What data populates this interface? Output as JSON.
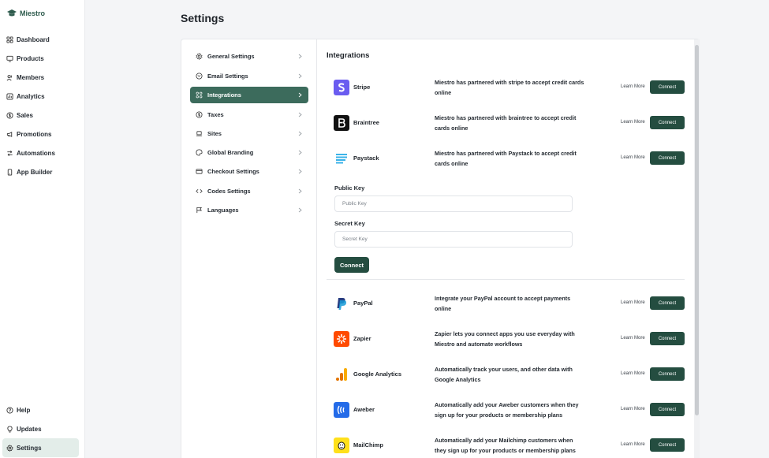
{
  "brand": {
    "name": "Miestro",
    "color": "#2d5a4c"
  },
  "sidebar": {
    "items": [
      {
        "label": "Dashboard",
        "icon": "grid-icon"
      },
      {
        "label": "Products",
        "icon": "monitor-icon"
      },
      {
        "label": "Members",
        "icon": "users-icon"
      },
      {
        "label": "Analytics",
        "icon": "chart-icon"
      },
      {
        "label": "Sales",
        "icon": "dollar-icon"
      },
      {
        "label": "Promotions",
        "icon": "megaphone-icon"
      },
      {
        "label": "Automations",
        "icon": "arrows-icon"
      },
      {
        "label": "App Builder",
        "icon": "phone-icon"
      }
    ],
    "bottom": [
      {
        "label": "Help",
        "icon": "help-icon"
      },
      {
        "label": "Updates",
        "icon": "bulb-icon"
      },
      {
        "label": "Settings",
        "icon": "gear-icon",
        "active": true
      }
    ]
  },
  "page": {
    "title": "Settings"
  },
  "settings_menu": [
    {
      "label": "General Settings",
      "icon": "gear-icon"
    },
    {
      "label": "Email Settings",
      "icon": "mail-icon"
    },
    {
      "label": "Integrations",
      "icon": "integrations-icon",
      "active": true
    },
    {
      "label": "Taxes",
      "icon": "dollar-icon"
    },
    {
      "label": "Sites",
      "icon": "laptop-icon"
    },
    {
      "label": "Global Branding",
      "icon": "paint-icon"
    },
    {
      "label": "Checkout Settings",
      "icon": "cart-icon"
    },
    {
      "label": "Codes Settings",
      "icon": "code-icon"
    },
    {
      "label": "Languages",
      "icon": "flag-icon"
    }
  ],
  "integrations": {
    "title": "Integrations",
    "learn_more": "Learn More",
    "connect": "Connect",
    "items": [
      {
        "name": "Stripe",
        "desc": "Miestro has partnered with stripe to accept credit cards online"
      },
      {
        "name": "Braintree",
        "desc": "Miestro has partnered with braintree to accept credit cards online"
      },
      {
        "name": "Paystack",
        "desc": "Miestro has partnered with Paystack to accept credit cards online"
      },
      {
        "name": "PayPal",
        "desc": "Integrate your PayPal account to accept payments online"
      },
      {
        "name": "Zapier",
        "desc": "Zapier lets you connect apps you use everyday with Miestro and automate workflows"
      },
      {
        "name": "Google Analytics",
        "desc": "Automatically track your users, and other data with Google Analytics"
      },
      {
        "name": "Aweber",
        "desc": "Automatically add your Aweber customers when they sign up for your products or membership plans"
      },
      {
        "name": "MailChimp",
        "desc": "Automatically add your Mailchimp customers when they sign up for your products or membership plans"
      }
    ],
    "paystack_form": {
      "public_key_label": "Public Key",
      "public_key_placeholder": "Public Key",
      "secret_key_label": "Secret Key",
      "secret_key_placeholder": "Secret Key",
      "connect": "Connect"
    }
  },
  "colors": {
    "accent": "#244d40",
    "active_menu": "#3c6b5c"
  }
}
